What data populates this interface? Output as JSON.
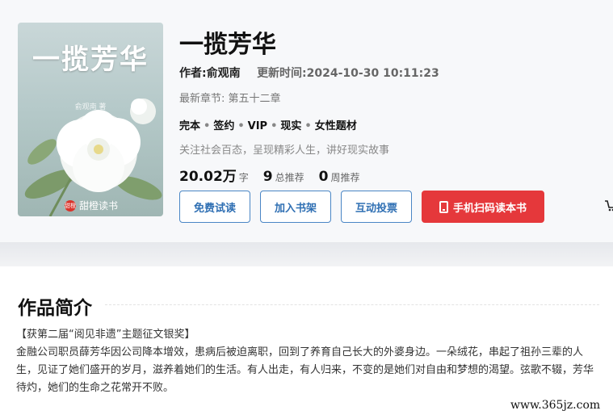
{
  "book": {
    "cover_title": "一揽芳华",
    "cover_author": "俞观南 著",
    "cover_badge": "甜橙",
    "cover_brand": "甜橙读书",
    "title": "一揽芳华",
    "author": "作者:俞观南",
    "updated": "更新时间:2024-10-30 10:11:23",
    "latest_chapter": "最新章节: 第五十二章",
    "tags": [
      "完本",
      "签约",
      "VIP",
      "现实",
      "女性题材"
    ],
    "tag_separator": "•",
    "description": "关注社会百态，呈现精彩人生，讲好现实故事",
    "stats": {
      "words_num": "20.02万",
      "words_unit": "字",
      "total_rec_num": "9",
      "total_rec_unit": "总推荐",
      "week_rec_num": "0",
      "week_rec_unit": "周推荐"
    }
  },
  "actions": {
    "read": "免费试读",
    "shelf": "加入书架",
    "vote": "互动投票",
    "scan": "手机扫码读本书"
  },
  "intro": {
    "heading": "作品简介",
    "award": "【获第二届“阅见非遗”主题征文银奖】",
    "body": "金融公司职员薛芳华因公司降本增效，患病后被迫离职，回到了养育自己长大的外婆身边。一朵绒花，串起了祖孙三辈的人生，见证了她们盛开的岁月，滋养着她们的生活。有人出走，有人归来，不变的是她们对自由和梦想的渴望。弦歌不辍，芳华待灼，她们的生命之花常开不败。"
  },
  "watermark": "www.365jz.com"
}
